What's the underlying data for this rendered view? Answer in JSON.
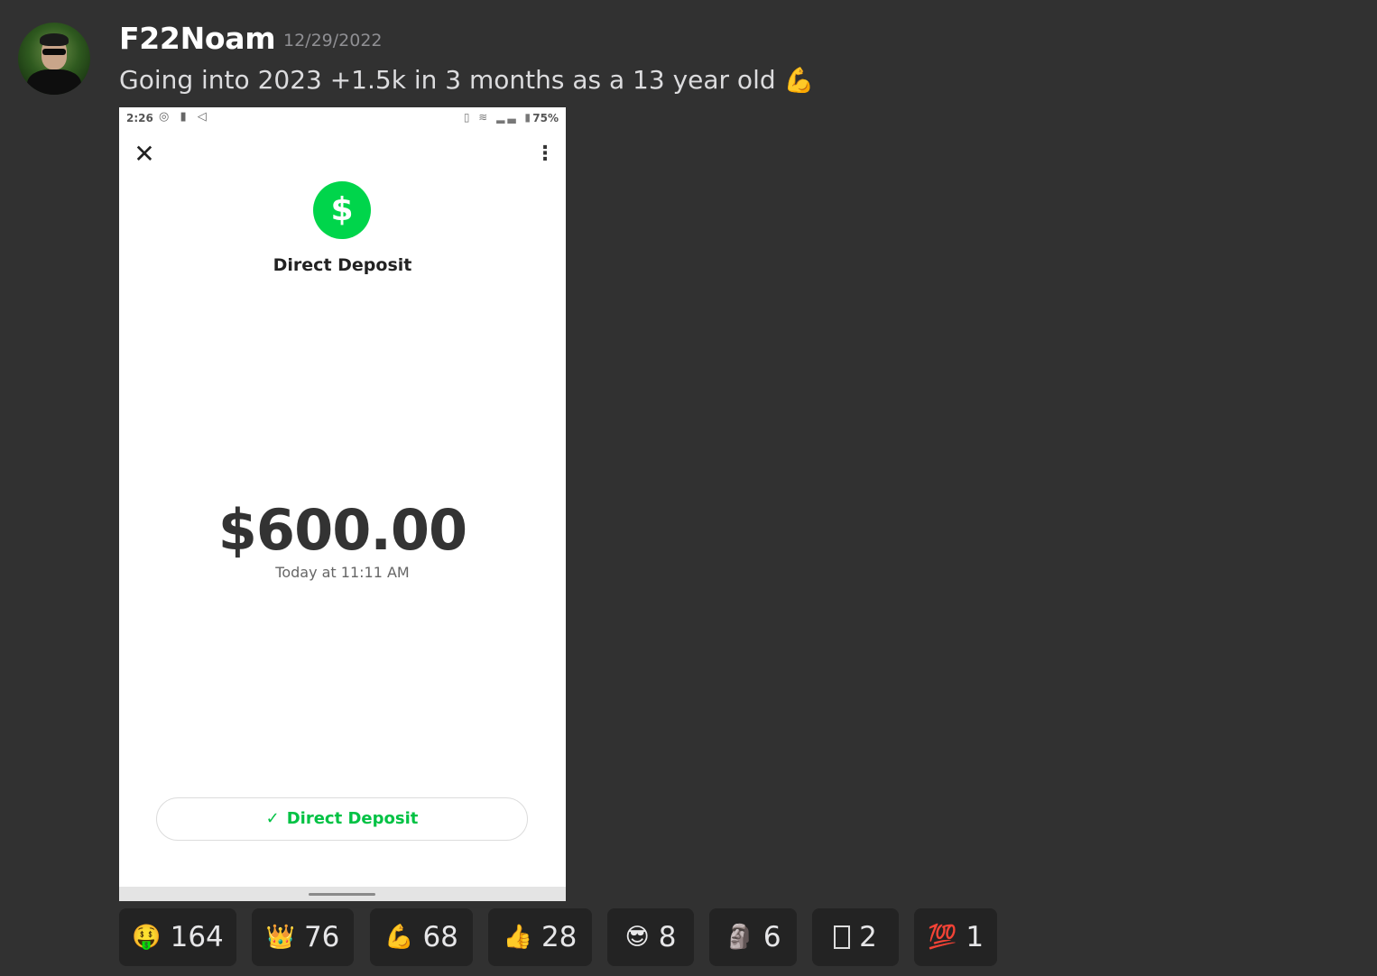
{
  "post": {
    "username": "F22Noam",
    "date": "12/29/2022",
    "message_text": "Going into 2023 +1.5k in 3 months as a 13 year old",
    "message_emoji": "💪"
  },
  "screenshot": {
    "status_time": "2:26",
    "status_battery": "75%",
    "close_icon": "✕",
    "more_icon": "⋮",
    "dollar_symbol": "$",
    "title": "Direct Deposit",
    "amount": "$600.00",
    "time_text": "Today at 11:11 AM",
    "button_check": "✓",
    "button_label": "Direct Deposit",
    "accent_color": "#00d54b"
  },
  "reactions": [
    {
      "emoji": "🤑",
      "count": "164",
      "icon": "money-mouth-face-icon"
    },
    {
      "emoji": "👑",
      "count": "76",
      "icon": "crown-icon"
    },
    {
      "emoji": "💪",
      "count": "68",
      "icon": "flexed-biceps-icon"
    },
    {
      "emoji": "👍",
      "count": "28",
      "icon": "thumbs-up-icon"
    },
    {
      "emoji": "😎",
      "count": "8",
      "icon": "sunglasses-face-icon"
    },
    {
      "emoji": "🗿",
      "count": "6",
      "icon": "moai-icon"
    },
    {
      "emoji": "",
      "count": "2",
      "icon": "missing-glyph-icon"
    },
    {
      "emoji": "💯",
      "count": "1",
      "icon": "hundred-points-icon"
    }
  ]
}
